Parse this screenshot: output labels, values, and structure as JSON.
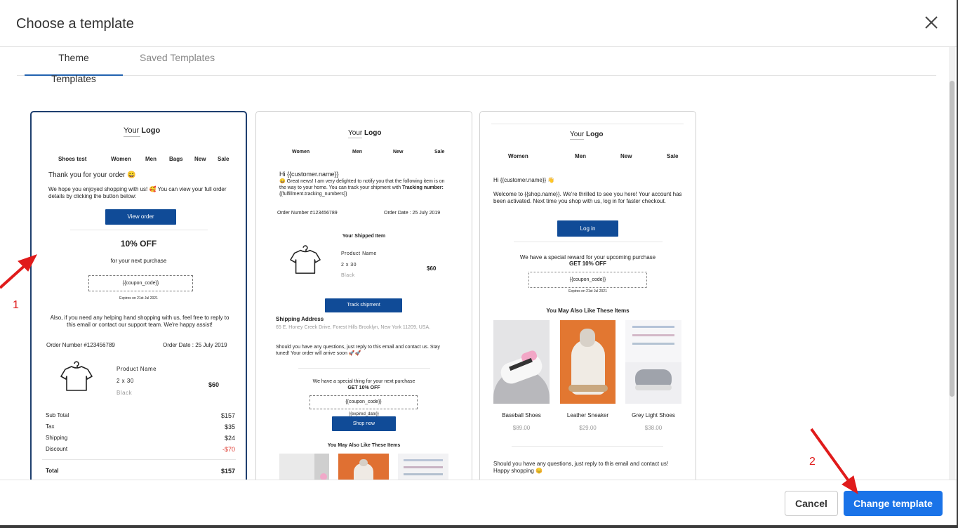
{
  "modal": {
    "title": "Choose a template"
  },
  "tabs": [
    {
      "label": "Theme Templates",
      "active": true
    },
    {
      "label": "Saved Templates",
      "active": false
    }
  ],
  "colors": {
    "primary_button": "#1a73e8",
    "template_button": "#104b97",
    "annotation": "#e01b1b",
    "discount": "#e0433a"
  },
  "template1": {
    "logo_your": "Your",
    "logo_bold": "Logo",
    "nav": [
      "Shoes test",
      "Women",
      "Men",
      "Bags",
      "New",
      "Sale"
    ],
    "heading": "Thank you for your order 😄",
    "message": "We hope you enjoyed shopping with us! 🥰 You can view your full order details by clicking the button below:",
    "view_order": "View order",
    "discount_title": "10% OFF",
    "discount_sub": "for your next purchase",
    "coupon": "{{coupon_code}}",
    "expires": "Expires on 21st Jul 2021",
    "help_text": "Also, if you need any helping hand shopping with us, feel free to reply to this email or contact our support team. We're happy assist!",
    "order_number": "Order Number #123456789",
    "order_date": "Order Date : 25 July 2019",
    "product_name": "Product Name",
    "product_qty": "2 x 30",
    "product_color": "Black",
    "product_price": "$60",
    "totals": [
      {
        "label": "Sub Total",
        "value": "$157"
      },
      {
        "label": "Tax",
        "value": "$35"
      },
      {
        "label": "Shipping",
        "value": "$24"
      },
      {
        "label": "Discount",
        "value": "-$70"
      }
    ],
    "total_label": "Total",
    "total_value": "$157"
  },
  "template2": {
    "logo_your": "Your",
    "logo_bold": "Logo",
    "nav": [
      "Women",
      "Men",
      "New",
      "Sale"
    ],
    "greeting": "Hi {{customer.name}}",
    "message_a": "😄 Great news! I am very delighted to notify you that the following item is on the way to your home. You can track your shipment with ",
    "message_b": "Tracking number:",
    "message_c": " {{fulfillment.tracking_numbers}}",
    "order_number": "Order Number #123456789",
    "order_date": "Order Date : 25 July 2019",
    "shipped_title": "Your Shipped Item",
    "product_name": "Product Name",
    "product_qty": "2 x 30",
    "product_color": "Black",
    "product_price": "$60",
    "track_button": "Track shipment",
    "shipping_title": "Shipping Address",
    "shipping_address": "65 E. Honey Creek Drive, Forest Hills Brooklyn, New York 11209, USA.",
    "questions": "Should you have any questions, just reply to this email and contact us. Stay tuned! Your order will arrive soon 🚀🚀",
    "special": "We have a special thing for your next purchase",
    "special_off": "GET 10% OFF",
    "coupon": "{{coupon_code}}",
    "expired": "{{expired_date}}",
    "shop_now": "Shop now",
    "also_like": "You May Also Like These Items"
  },
  "template3": {
    "logo_your": "Your",
    "logo_bold": "Logo",
    "nav": [
      "Women",
      "Men",
      "New",
      "Sale"
    ],
    "greeting": "Hi {{customer.name}} 👋",
    "welcome": "Welcome to {{shop.name}}. We're thrilled to see you here! Your account has been activated.  Next time you shop with us, log in for faster checkout.",
    "login": "Log in",
    "reward": "We have a special reward for your upcoming purchase",
    "reward_off": "GET 10% OFF",
    "coupon": "{{coupon_code}}",
    "expires": "Expires on 21st Jul 2021",
    "also_like": "You May Also Like These Items",
    "products": [
      {
        "name": "Baseball Shoes",
        "price": "$89.00"
      },
      {
        "name": "Leather Sneaker",
        "price": "$29.00"
      },
      {
        "name": "Grey Light Shoes",
        "price": "$38.00"
      }
    ],
    "closing": "Should you have any questions, just reply to this email and contact us! Happy shopping 😊"
  },
  "footer": {
    "cancel": "Cancel",
    "change": "Change template"
  },
  "annotations": {
    "one": "1",
    "two": "2"
  }
}
